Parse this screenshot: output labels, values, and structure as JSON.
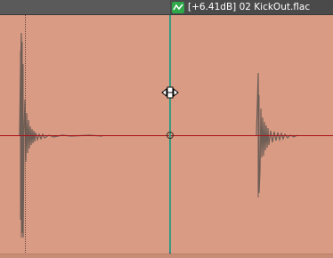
{
  "clip": {
    "title": "[+6.41dB] 02 KickOut.flac",
    "icon": "envelope-icon"
  },
  "colors": {
    "clip_background": "#d99b84",
    "waveform": "#6e5e56",
    "zero_line": "#a8101a",
    "cursor_line": "#3d9a80",
    "envelope_icon": "#2fa84a"
  }
}
